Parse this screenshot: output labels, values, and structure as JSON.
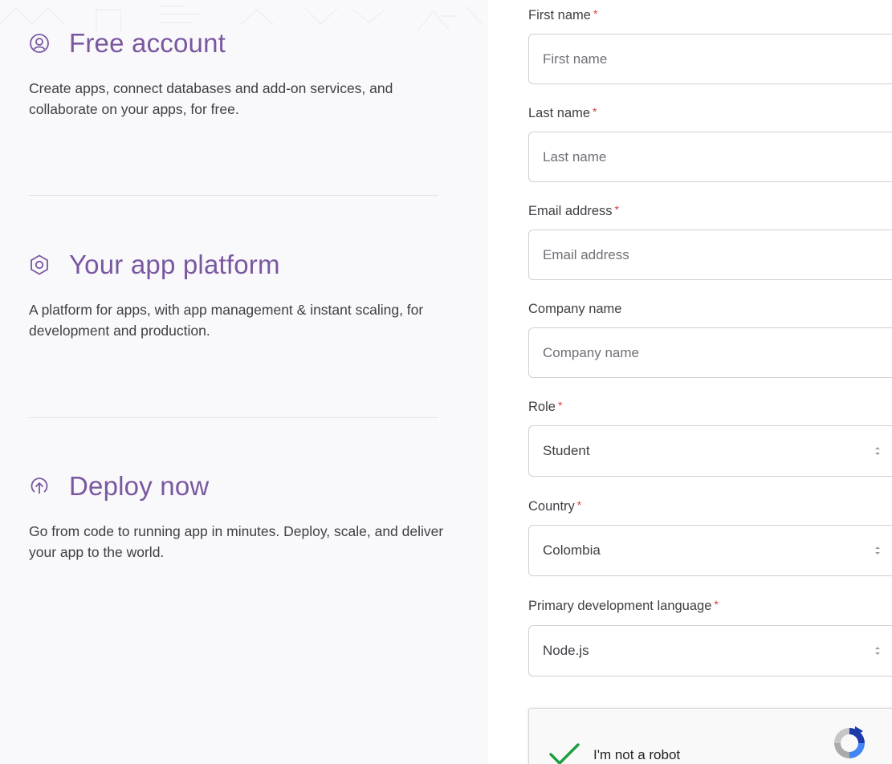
{
  "features": [
    {
      "icon": "user-circle-icon",
      "title": "Free account",
      "description": "Create apps, connect databases and add-on services, and collaborate on your apps, for free."
    },
    {
      "icon": "hexagon-icon",
      "title": "Your app platform",
      "description": "A platform for apps, with app management & instant scaling, for development and production."
    },
    {
      "icon": "upload-arrow-icon",
      "title": "Deploy now",
      "description": "Go from code to running app in minutes. Deploy, scale, and deliver your app to the world."
    }
  ],
  "form": {
    "required_mark": "*",
    "first_name": {
      "label": "First name",
      "placeholder": "First name",
      "value": ""
    },
    "last_name": {
      "label": "Last name",
      "placeholder": "Last name",
      "value": ""
    },
    "email": {
      "label": "Email address",
      "placeholder": "Email address",
      "value": ""
    },
    "company": {
      "label": "Company name",
      "placeholder": "Company name",
      "value": ""
    },
    "role": {
      "label": "Role",
      "selected": "Student"
    },
    "country": {
      "label": "Country",
      "selected": "Colombia"
    },
    "language": {
      "label": "Primary development language",
      "selected": "Node.js"
    }
  },
  "captcha": {
    "label": "I'm not a robot",
    "checked": true
  },
  "colors": {
    "accent": "#79589f",
    "required": "#d83b3b",
    "check": "#1a9e3f"
  }
}
